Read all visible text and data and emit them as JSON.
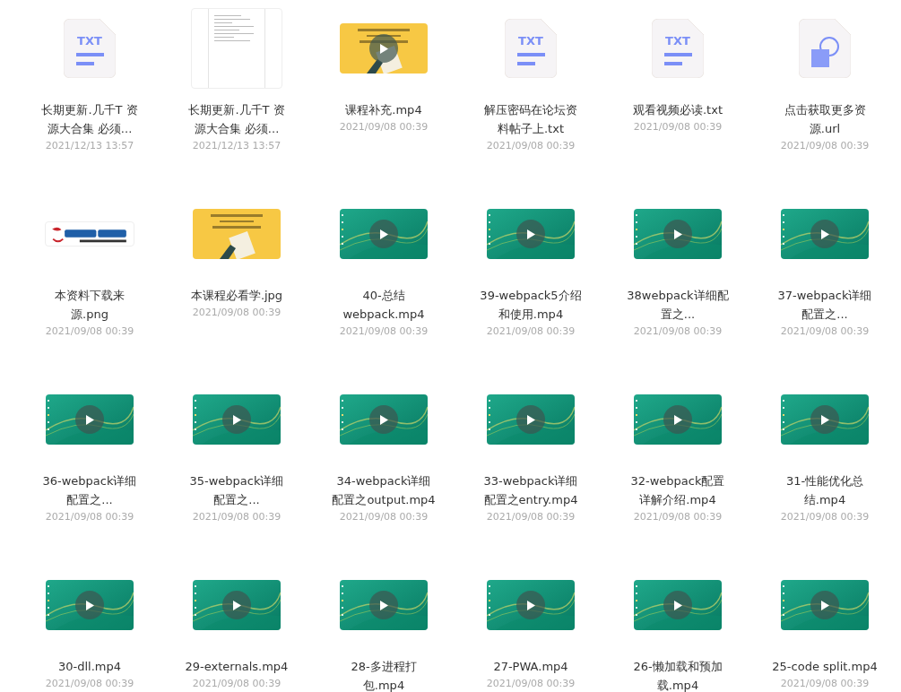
{
  "files": [
    {
      "kind": "txt",
      "label": "TXT",
      "name": [
        "长期更新.几千T 资",
        "源大合集 必须..."
      ],
      "date": "2021/12/13 13:57"
    },
    {
      "kind": "document",
      "name": [
        "长期更新.几千T 资",
        "源大合集 必须..."
      ],
      "date": "2021/12/13 13:57"
    },
    {
      "kind": "promo",
      "name": [
        "课程补充.mp4"
      ],
      "date": "2021/09/08 00:39"
    },
    {
      "kind": "txt",
      "label": "TXT",
      "name": [
        "解压密码在论坛资",
        "料帖子上.txt"
      ],
      "date": "2021/09/08 00:39"
    },
    {
      "kind": "txt",
      "label": "TXT",
      "name": [
        "观看视频必读.txt"
      ],
      "date": "2021/09/08 00:39"
    },
    {
      "kind": "url",
      "name": [
        "点击获取更多资",
        "源.url"
      ],
      "date": "2021/09/08 00:39"
    },
    {
      "kind": "logo",
      "name": [
        "本资料下载来",
        "源.png"
      ],
      "date": "2021/09/08 00:39"
    },
    {
      "kind": "poster",
      "name": [
        "本课程必看学.jpg"
      ],
      "date": "2021/09/08 00:39"
    },
    {
      "kind": "video",
      "name": [
        "40-总结",
        "webpack.mp4"
      ],
      "date": "2021/09/08 00:39"
    },
    {
      "kind": "video",
      "name": [
        "39-webpack5介绍",
        "和使用.mp4"
      ],
      "date": "2021/09/08 00:39"
    },
    {
      "kind": "video",
      "name": [
        "38webpack详细配",
        "置之..."
      ],
      "date": "2021/09/08 00:39"
    },
    {
      "kind": "video",
      "name": [
        "37-webpack详细",
        "配置之..."
      ],
      "date": "2021/09/08 00:39"
    },
    {
      "kind": "video",
      "name": [
        "36-webpack详细",
        "配置之..."
      ],
      "date": "2021/09/08 00:39"
    },
    {
      "kind": "video",
      "name": [
        "35-webpack详细",
        "配置之..."
      ],
      "date": "2021/09/08 00:39"
    },
    {
      "kind": "video",
      "name": [
        "34-webpack详细",
        "配置之output.mp4"
      ],
      "date": "2021/09/08 00:39"
    },
    {
      "kind": "video",
      "name": [
        "33-webpack详细",
        "配置之entry.mp4"
      ],
      "date": "2021/09/08 00:39"
    },
    {
      "kind": "video",
      "name": [
        "32-webpack配置",
        "详解介绍.mp4"
      ],
      "date": "2021/09/08 00:39"
    },
    {
      "kind": "video",
      "name": [
        "31-性能优化总",
        "结.mp4"
      ],
      "date": "2021/09/08 00:39"
    },
    {
      "kind": "video",
      "name": [
        "30-dll.mp4"
      ],
      "date": "2021/09/08 00:39"
    },
    {
      "kind": "video",
      "name": [
        "29-externals.mp4"
      ],
      "date": "2021/09/08 00:39"
    },
    {
      "kind": "video",
      "name": [
        "28-多进程打",
        "包.mp4"
      ]
    },
    {
      "kind": "video",
      "name": [
        "27-PWA.mp4"
      ],
      "date": "2021/09/08 00:39"
    },
    {
      "kind": "video",
      "name": [
        "26-懒加载和预加",
        "载.mp4"
      ]
    },
    {
      "kind": "video",
      "name": [
        "25-code split.mp4"
      ],
      "date": "2021/09/08 00:39"
    }
  ]
}
